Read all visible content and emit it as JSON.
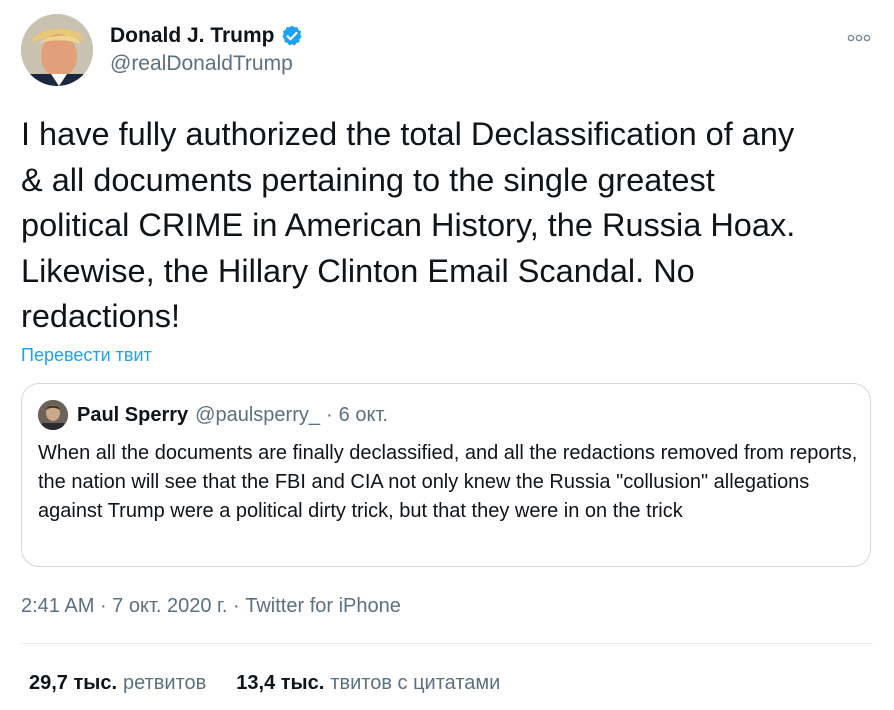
{
  "author": {
    "display_name": "Donald J. Trump",
    "handle": "@realDonaldTrump",
    "verified": true,
    "verified_icon": "verified-badge-icon",
    "more_icon": "more-options-icon"
  },
  "tweet": {
    "text": "I have fully authorized the total Declassification of any\n& all documents pertaining to the single greatest\npolitical CRIME in American History, the Russia Hoax.\nLikewise, the Hillary Clinton Email Scandal. No\nredactions!",
    "translate_label": "Перевести твит"
  },
  "quote": {
    "display_name": "Paul Sperry",
    "handle": "@paulsperry_",
    "separator": "·",
    "date": "6 окт.",
    "text": "When all the documents are finally declassified, and all the redactions removed from reports, the nation will see that the FBI and CIA not only knew the Russia \"collusion\" allegations against Trump were a political dirty trick, but that they were in on the trick"
  },
  "meta": {
    "time": "2:41 AM",
    "dot1": " · ",
    "date": "7 окт. 2020 г.",
    "dot2": " · ",
    "source": "Twitter for iPhone"
  },
  "stats": {
    "retweets_count": "29,7 тыс.",
    "retweets_label": "ретвитов",
    "quotes_count": "13,4 тыс.",
    "quotes_label": "твитов с цитатами"
  },
  "colors": {
    "accent": "#1da1f2",
    "secondary_text": "#5b7083",
    "border": "#cfd9de"
  }
}
